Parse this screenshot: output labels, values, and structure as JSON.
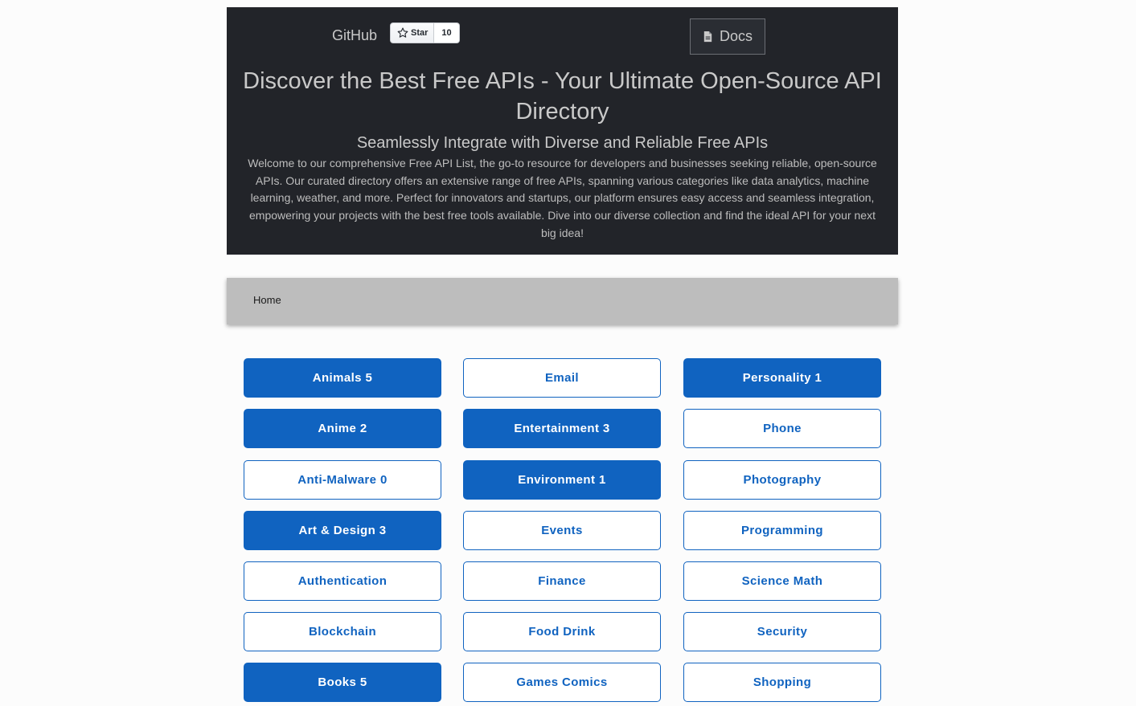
{
  "header": {
    "github_label": "GitHub",
    "star_label": "Star",
    "star_count": "10",
    "docs_label": "Docs",
    "title": "Discover the Best Free APIs - Your Ultimate Open-Source API Directory",
    "subtitle": "Seamlessly Integrate with Diverse and Reliable Free APIs",
    "description": "Welcome to our comprehensive Free API List, the go-to resource for developers and businesses seeking reliable, open-source APIs. Our curated directory offers an extensive range of free APIs, spanning various categories like data analytics, machine learning, weather, and more. Perfect for innovators and startups, our platform ensures easy access and seamless integration, empowering your projects with the best free tools available. Dive into our diverse collection and find the ideal API for your next big idea!"
  },
  "nav": {
    "home_label": "Home"
  },
  "colors": {
    "primary": "#1063c0",
    "hero_bg": "#222429",
    "nav_bg": "#bdbdbd"
  },
  "categories": {
    "col1": [
      {
        "label": "Animals 5",
        "style": "filled"
      },
      {
        "label": "Anime 2",
        "style": "filled"
      },
      {
        "label": "Anti-Malware 0",
        "style": "outline"
      },
      {
        "label": "Art & Design 3",
        "style": "filled"
      },
      {
        "label": "Authentication",
        "style": "outline"
      },
      {
        "label": "Blockchain",
        "style": "outline"
      },
      {
        "label": "Books 5",
        "style": "filled"
      }
    ],
    "col2": [
      {
        "label": "Email",
        "style": "outline"
      },
      {
        "label": "Entertainment 3",
        "style": "filled"
      },
      {
        "label": "Environment 1",
        "style": "filled"
      },
      {
        "label": "Events",
        "style": "outline"
      },
      {
        "label": "Finance",
        "style": "outline"
      },
      {
        "label": "Food Drink",
        "style": "outline"
      },
      {
        "label": "Games Comics",
        "style": "outline"
      }
    ],
    "col3": [
      {
        "label": "Personality 1",
        "style": "filled"
      },
      {
        "label": "Phone",
        "style": "outline"
      },
      {
        "label": "Photography",
        "style": "outline"
      },
      {
        "label": "Programming",
        "style": "outline"
      },
      {
        "label": "Science Math",
        "style": "outline"
      },
      {
        "label": "Security",
        "style": "outline"
      },
      {
        "label": "Shopping",
        "style": "outline"
      }
    ]
  }
}
